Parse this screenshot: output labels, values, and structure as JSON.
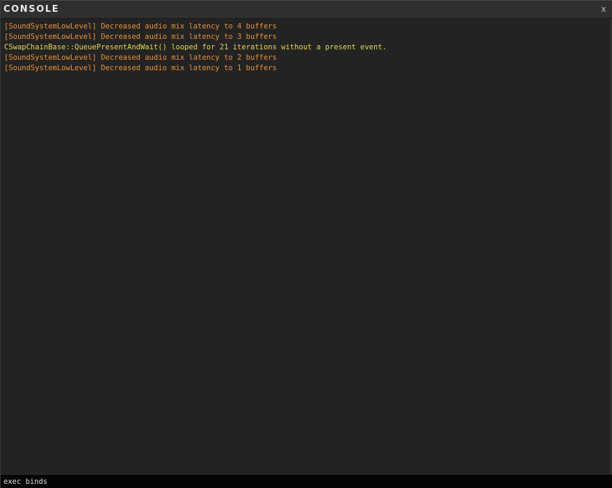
{
  "window": {
    "title": "CONSOLE",
    "close_label": "x"
  },
  "log": [
    {
      "text": "[SoundSystemLowLevel] Decreased audio mix latency to 4 buffers",
      "color": "#e8913a"
    },
    {
      "text": "[SoundSystemLowLevel] Decreased audio mix latency to 3 buffers",
      "color": "#e8913a"
    },
    {
      "text": "CSwapChainBase::QueuePresentAndWait() looped for 21 iterations without a present event.",
      "color": "#e3d85a"
    },
    {
      "text": "[SoundSystemLowLevel] Decreased audio mix latency to 2 buffers",
      "color": "#e8913a"
    },
    {
      "text": "[SoundSystemLowLevel] Decreased audio mix latency to 1 buffers",
      "color": "#e8913a"
    }
  ],
  "input": {
    "value": "exec binds"
  },
  "colors": {
    "background": "#232323",
    "titlebar": "#2f2f2f",
    "input_bar": "#050505",
    "log_orange": "#e8913a",
    "log_yellow": "#e3d85a"
  }
}
